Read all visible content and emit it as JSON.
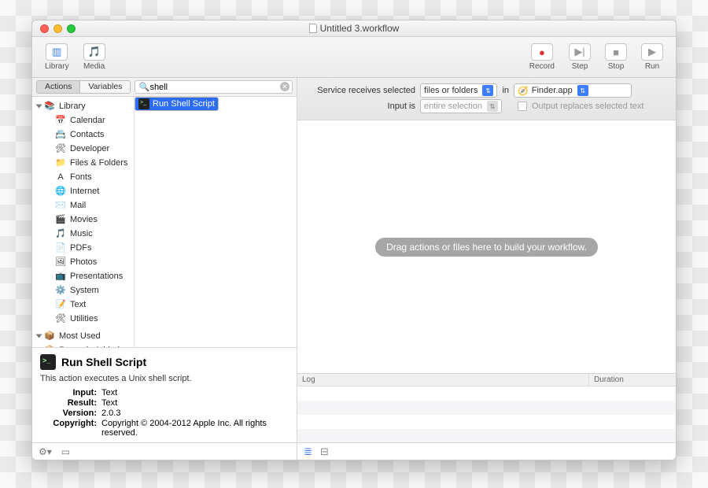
{
  "window": {
    "title": "Untitled 3.workflow"
  },
  "toolbar_left": {
    "library": "Library",
    "media": "Media"
  },
  "toolbar_right": {
    "record": "Record",
    "step": "Step",
    "stop": "Stop",
    "run": "Run"
  },
  "tabs": {
    "actions": "Actions",
    "variables": "Variables"
  },
  "search": {
    "placeholder": "",
    "value": "shell"
  },
  "categories": [
    {
      "label": "Library",
      "glyph": "📚",
      "top": true
    },
    {
      "label": "Calendar",
      "glyph": "📅"
    },
    {
      "label": "Contacts",
      "glyph": "📇"
    },
    {
      "label": "Developer",
      "glyph": "🛠"
    },
    {
      "label": "Files & Folders",
      "glyph": "📁"
    },
    {
      "label": "Fonts",
      "glyph": "A"
    },
    {
      "label": "Internet",
      "glyph": "🌐"
    },
    {
      "label": "Mail",
      "glyph": "✉️"
    },
    {
      "label": "Movies",
      "glyph": "🎬"
    },
    {
      "label": "Music",
      "glyph": "🎵"
    },
    {
      "label": "PDFs",
      "glyph": "📄"
    },
    {
      "label": "Photos",
      "glyph": "🖼"
    },
    {
      "label": "Presentations",
      "glyph": "📺"
    },
    {
      "label": "System",
      "glyph": "⚙️"
    },
    {
      "label": "Text",
      "glyph": "📝"
    },
    {
      "label": "Utilities",
      "glyph": "🛠"
    },
    {
      "label": "Most Used",
      "glyph": "📦",
      "top": true,
      "spacer": true
    },
    {
      "label": "Recently Added",
      "glyph": "📦",
      "top": true
    }
  ],
  "results": [
    {
      "label": "Run Shell Script",
      "selected": true
    }
  ],
  "detail": {
    "title": "Run Shell Script",
    "desc": "This action executes a Unix shell script.",
    "input_k": "Input:",
    "input_v": "Text",
    "result_k": "Result:",
    "result_v": "Text",
    "version_k": "Version:",
    "version_v": "2.0.3",
    "copyright_k": "Copyright:",
    "copyright_v": "Copyright © 2004-2012 Apple Inc.  All rights reserved."
  },
  "config": {
    "row1_label": "Service receives selected",
    "row1_sel": "files or folders",
    "row1_in": "in",
    "row1_app": "Finder.app",
    "row2_label": "Input is",
    "row2_sel": "entire selection",
    "row2_cb_label": "Output replaces selected text"
  },
  "canvas_hint": "Drag actions or files here to build your workflow.",
  "log": {
    "col1": "Log",
    "col2": "Duration"
  }
}
